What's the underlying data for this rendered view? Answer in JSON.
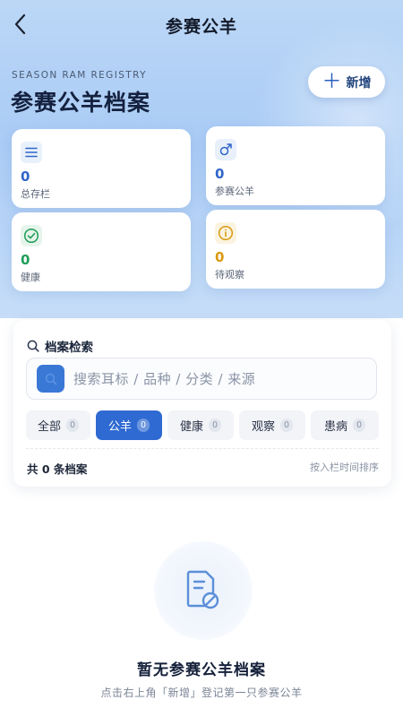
{
  "nav": {
    "title": "参赛公羊"
  },
  "header": {
    "eyebrow": "SEASON RAM REGISTRY",
    "title": "参赛公羊档案",
    "add_label": "新增"
  },
  "stats": [
    {
      "value": "0",
      "label": "总存栏",
      "icon": "list-icon",
      "color": "#2f66c9"
    },
    {
      "value": "0",
      "label": "参赛公羊",
      "icon": "male-icon",
      "color": "#2f66c9"
    },
    {
      "value": "0",
      "label": "健康",
      "icon": "check-circle-icon",
      "color": "#1f9d57"
    },
    {
      "value": "0",
      "label": "待观察",
      "icon": "info-circle-icon",
      "color": "#d99a12"
    }
  ],
  "search": {
    "title": "档案检索",
    "placeholder": "搜索耳标 / 品种 / 分类 / 来源"
  },
  "filters": [
    {
      "label": "全部",
      "count": "0",
      "active": false
    },
    {
      "label": "公羊",
      "count": "0",
      "active": true
    },
    {
      "label": "健康",
      "count": "0",
      "active": false
    },
    {
      "label": "观察",
      "count": "0",
      "active": false
    },
    {
      "label": "患病",
      "count": "0",
      "active": false
    }
  ],
  "summary": {
    "count_text": "共 0 条档案",
    "sort_text": "按入栏时间排序"
  },
  "empty": {
    "title": "暂无参赛公羊档案",
    "subtitle": "点击右上角「新增」登记第一只参赛公羊"
  },
  "colors": {
    "accent": "#2f6ad2",
    "brand_dark": "#14213f"
  }
}
